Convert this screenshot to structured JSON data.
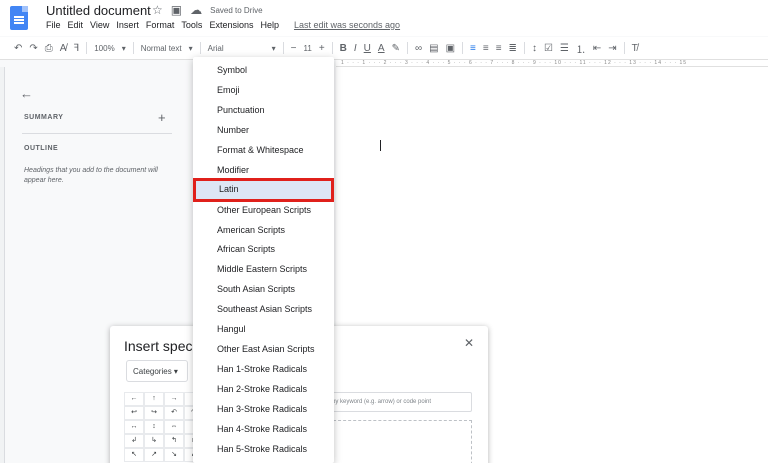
{
  "header": {
    "doc_title": "Untitled document",
    "saved_status": "Saved to Drive",
    "last_edit": "Last edit was seconds ago",
    "menu": [
      "File",
      "Edit",
      "View",
      "Insert",
      "Format",
      "Tools",
      "Extensions",
      "Help"
    ]
  },
  "toolbar": {
    "zoom": "100%",
    "style": "Normal text",
    "font": "Arial",
    "font_size": "11"
  },
  "ruler": {
    "marks": "1 · · · 1 · · · 2 · · · 3 · · · 4 · · · 5 · · · 6 · · · 7 · · · 8 · · · 9 · · · 10 · · · 11 · · · 12 · · · 13 · · · 14 · · · 15"
  },
  "outline_panel": {
    "summary_label": "SUMMARY",
    "outline_label": "OUTLINE",
    "hint": "Headings that you add to the document will appear here."
  },
  "dialog": {
    "title": "Insert spec",
    "category": "Categories",
    "search_placeholder": "by keyword (e.g. arrow) or code point",
    "chars": [
      "←",
      "↑",
      "→",
      "↓",
      "↩",
      "↪",
      "↶",
      "↷",
      "↔",
      "↕",
      "⇔",
      "↨",
      "↲",
      "↳",
      "↰",
      "↱",
      "↖",
      "↗",
      "↘",
      "↙"
    ]
  },
  "category_menu": {
    "items": [
      "Symbol",
      "Emoji",
      "Punctuation",
      "Number",
      "Format & Whitespace",
      "Modifier",
      "Latin",
      "Other European Scripts",
      "American Scripts",
      "African Scripts",
      "Middle Eastern Scripts",
      "South Asian Scripts",
      "Southeast Asian Scripts",
      "Hangul",
      "Other East Asian Scripts",
      "Han 1-Stroke Radicals",
      "Han 2-Stroke Radicals",
      "Han 3-Stroke Radicals",
      "Han 4-Stroke Radicals",
      "Han 5-Stroke Radicals"
    ],
    "selected": "Latin",
    "highlight_color": "#e0201b"
  },
  "colors": {
    "accent": "#4285f4"
  }
}
